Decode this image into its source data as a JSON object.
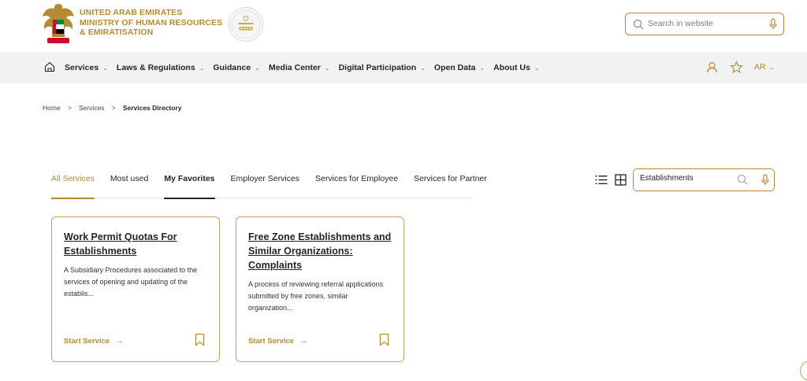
{
  "header": {
    "ministry_line1": "UNITED ARAB EMIRATES",
    "ministry_line2": "MINISTRY OF HUMAN RESOURCES",
    "ministry_line3": "& EMIRATISATION",
    "search_placeholder": "Search in website"
  },
  "nav": {
    "items": [
      {
        "label": "Services"
      },
      {
        "label": "Laws & Regulations"
      },
      {
        "label": "Guidance"
      },
      {
        "label": "Media Center"
      },
      {
        "label": "Digital Participation"
      },
      {
        "label": "Open Data"
      },
      {
        "label": "About Us"
      }
    ],
    "lang": "AR"
  },
  "breadcrumb": {
    "items": [
      "Home",
      "Services",
      "Services Directory"
    ]
  },
  "tabs": {
    "items": [
      {
        "label": "All Services"
      },
      {
        "label": "Most used"
      },
      {
        "label": "My Favorites"
      },
      {
        "label": "Employer Services"
      },
      {
        "label": "Services for Employee"
      },
      {
        "label": "Services for Partner"
      }
    ]
  },
  "filter": {
    "search_value": "Establishments"
  },
  "cards": [
    {
      "title": "Work Permit Quotas For Establishments",
      "description": "A Subsidiary Procedures associated to the services of opening and updating of the establis...",
      "action": "Start Service"
    },
    {
      "title": "Free Zone Establishments and Similar Organizations: Complaints",
      "description": "A process of reviewing referral applications submitted by free zones, similar organization...",
      "action": "Start Service"
    }
  ],
  "colors": {
    "gold": "#b68a35",
    "nav_bg": "#f2f2f2",
    "text": "#232528"
  },
  "icons": {
    "emblem": "uae-emblem-icon",
    "award": "award-badge-icon",
    "search": "search-icon",
    "mic": "microphone-icon",
    "home": "home-icon",
    "user": "user-icon",
    "favorite": "star-icon",
    "list_view": "list-view-icon",
    "grid_view": "grid-view-icon",
    "bookmark": "bookmark-icon",
    "arrow": "arrow-right-icon"
  }
}
